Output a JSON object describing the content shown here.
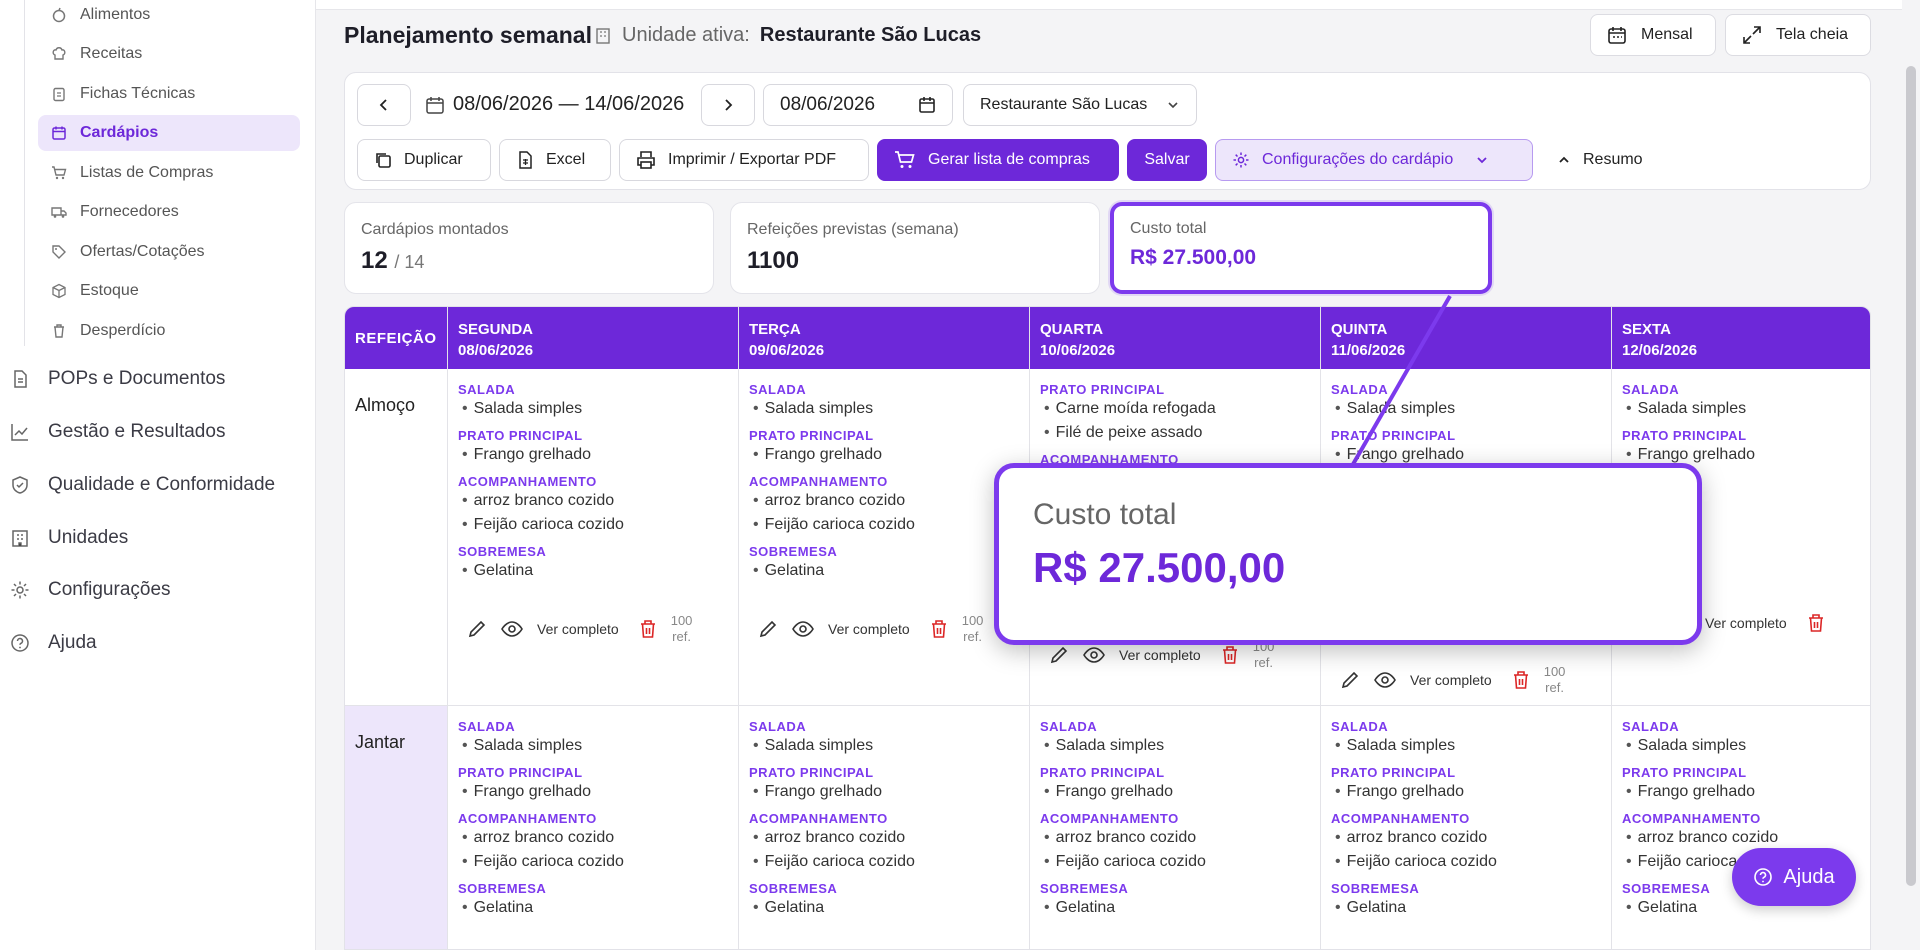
{
  "sidebar": {
    "sub_items": [
      {
        "label": "Alimentos",
        "icon": "apple-icon"
      },
      {
        "label": "Receitas",
        "icon": "chef-hat-icon"
      },
      {
        "label": "Fichas Técnicas",
        "icon": "clipboard-icon"
      },
      {
        "label": "Cardápios",
        "icon": "calendar-icon",
        "active": true
      },
      {
        "label": "Listas de Compras",
        "icon": "cart-icon"
      },
      {
        "label": "Fornecedores",
        "icon": "truck-icon"
      },
      {
        "label": "Ofertas/Cotações",
        "icon": "tag-icon"
      },
      {
        "label": "Estoque",
        "icon": "box-icon"
      },
      {
        "label": "Desperdício",
        "icon": "trash-icon"
      }
    ],
    "main_items": [
      {
        "label": "POPs e Documentos",
        "icon": "document-icon"
      },
      {
        "label": "Gestão e Resultados",
        "icon": "chart-line-icon"
      },
      {
        "label": "Qualidade e Conformidade",
        "icon": "shield-check-icon"
      },
      {
        "label": "Unidades",
        "icon": "building-icon"
      },
      {
        "label": "Configurações",
        "icon": "gear-icon"
      },
      {
        "label": "Ajuda",
        "icon": "help-circle-icon"
      }
    ]
  },
  "header": {
    "title": "Planejamento semanal",
    "unit_prefix": "Unidade ativa:",
    "unit_name": "Restaurante São Lucas",
    "monthly_label": "Mensal",
    "fullscreen_label": "Tela cheia"
  },
  "toolbar": {
    "date_range": "08/06/2026 — 14/06/2026",
    "date_input": "08/06/2026",
    "unit_select": "Restaurante São Lucas",
    "duplicate_label": "Duplicar",
    "excel_label": "Excel",
    "print_label": "Imprimir / Exportar PDF",
    "shopping_label": "Gerar lista de compras",
    "save_label": "Salvar",
    "config_label": "Configurações do cardápio",
    "summary_label": "Resumo"
  },
  "stats": {
    "menus_label": "Cardápios montados",
    "menus_value": "12",
    "menus_total": "/ 14",
    "meals_label": "Refeições previstas (semana)",
    "meals_value": "1100",
    "cost_label": "Custo total",
    "cost_value": "R$ 27.500,00"
  },
  "grid": {
    "meal_header": "REFEIÇÃO",
    "days": [
      {
        "name": "SEGUNDA",
        "date": "08/06/2026"
      },
      {
        "name": "TERÇA",
        "date": "09/06/2026"
      },
      {
        "name": "QUARTA",
        "date": "10/06/2026"
      },
      {
        "name": "QUINTA",
        "date": "11/06/2026"
      },
      {
        "name": "SEXTA",
        "date": "12/06/2026"
      }
    ],
    "meals": [
      "Almoço",
      "Jantar"
    ],
    "sections": {
      "salada": "SALADA",
      "prato": "PRATO PRINCIPAL",
      "acomp": "ACOMPANHAMENTO",
      "sobremesa": "SOBREMESA"
    },
    "items": {
      "salada_simples": "Salada simples",
      "frango": "Frango grelhado",
      "arroz": "arroz branco cozido",
      "feijao": "Feijão carioca cozido",
      "gelatina": "Gelatina",
      "carne_moida": "Carne moída refogada",
      "file_peixe": "Filé de peixe assado"
    },
    "action_view": "Ver completo",
    "ref_count": "100",
    "ref_unit": "ref."
  },
  "callout": {
    "label": "Custo total",
    "value": "R$ 27.500,00"
  },
  "help_fab": "Ajuda",
  "colors": {
    "accent": "#6d28d9",
    "accent_soft": "#ede6fb",
    "danger": "#dc2626"
  }
}
